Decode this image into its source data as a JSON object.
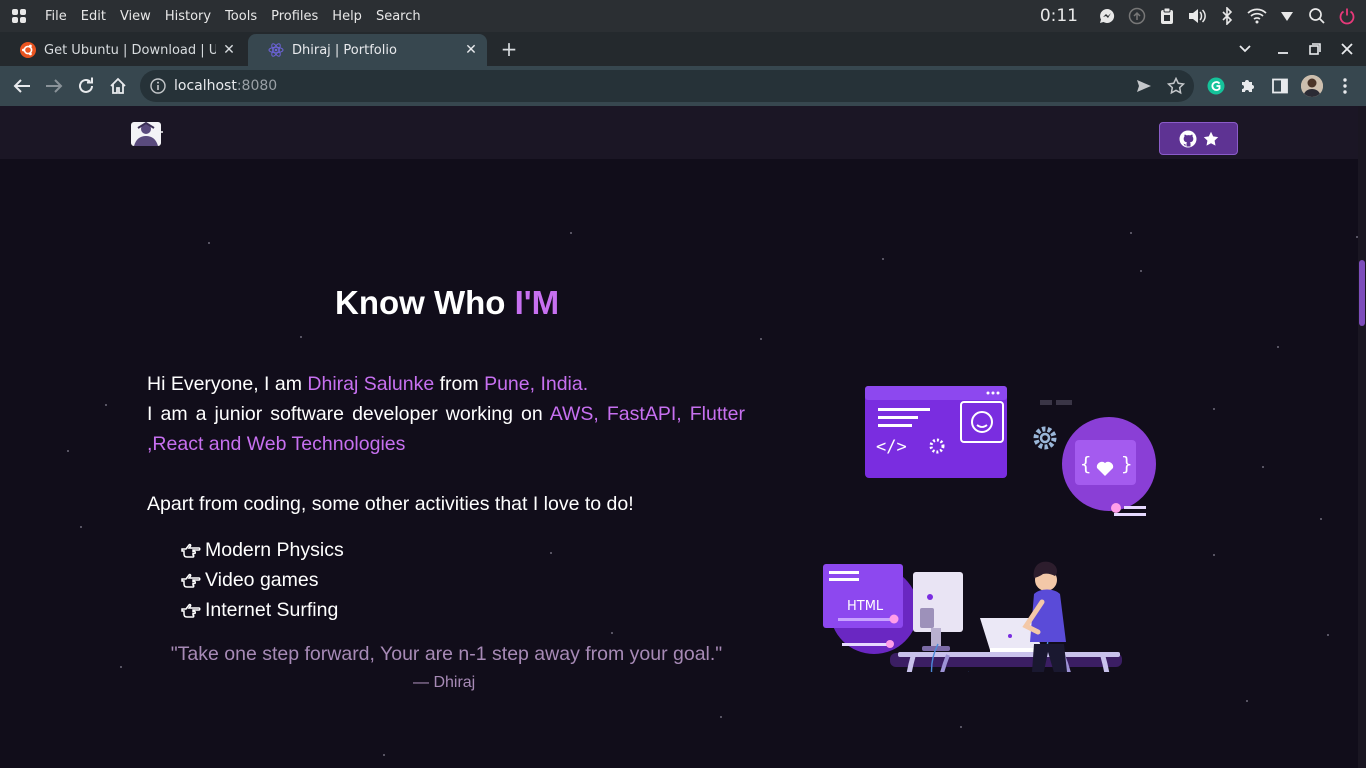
{
  "os": {
    "menu": [
      "File",
      "Edit",
      "View",
      "History",
      "Tools",
      "Profiles",
      "Help",
      "Search"
    ],
    "clock": "0:11",
    "tray_icons": [
      "messenger-icon",
      "update-icon",
      "clipboard-icon",
      "volume-icon",
      "bluetooth-icon",
      "wifi-icon",
      "dropdown-icon",
      "search-icon",
      "power-icon"
    ]
  },
  "browser": {
    "tabs": [
      {
        "title": "Get Ubuntu | Download | Ubuntu",
        "active": false
      },
      {
        "title": "Dhiraj | Portfolio",
        "active": true
      }
    ],
    "url_host": "localhost",
    "url_port": ":8080"
  },
  "page": {
    "heading_prefix": "Know Who ",
    "heading_highlight": "I'M",
    "intro_1": "Hi Everyone, I am ",
    "intro_name": "Dhiraj Salunke",
    "intro_2": " from ",
    "intro_place": "Pune, India.",
    "intro_3": "I am a junior software developer working on ",
    "intro_tech": "AWS, FastAPI, Flutter ,React and Web Technologies",
    "activities_intro": "Apart from coding, some other activities that I love to do!",
    "activities": [
      "Modern Physics",
      "Video games",
      "Internet Surfing"
    ],
    "quote": "\"Take one step forward, Your are n-1 step away from your goal.\"",
    "author": "— Dhiraj"
  },
  "colors": {
    "accent": "#c770f0",
    "background": "#110d1a",
    "button": "#5e3393"
  }
}
